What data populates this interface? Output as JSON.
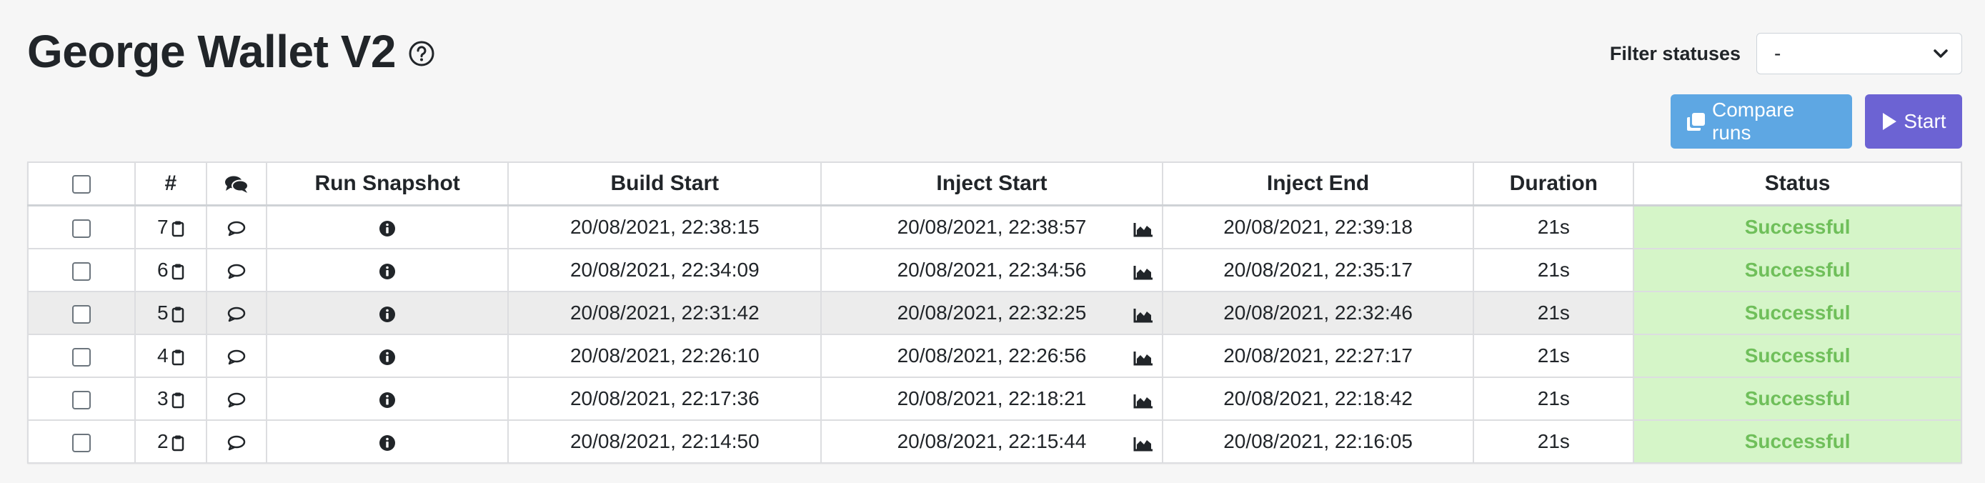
{
  "header": {
    "title": "George Wallet V2",
    "help_icon": "question-circle-icon"
  },
  "filter": {
    "label": "Filter statuses",
    "selected": "-"
  },
  "actions": {
    "compare_label": "Compare runs",
    "start_label": "Start"
  },
  "colors": {
    "compare_button": "#5ea7e3",
    "start_button": "#6c63d3",
    "status_success_bg": "#d5f5c8",
    "status_success_text": "#6fbf5a"
  },
  "table": {
    "columns": {
      "select": "",
      "number": "#",
      "comments": "",
      "snapshot": "Run Snapshot",
      "build_start": "Build Start",
      "inject_start": "Inject Start",
      "inject_end": "Inject End",
      "duration": "Duration",
      "status": "Status"
    },
    "rows": [
      {
        "id": "7",
        "build_start": "20/08/2021, 22:38:15",
        "inject_start": "20/08/2021, 22:38:57",
        "inject_end": "20/08/2021, 22:39:18",
        "duration": "21s",
        "status": "Successful"
      },
      {
        "id": "6",
        "build_start": "20/08/2021, 22:34:09",
        "inject_start": "20/08/2021, 22:34:56",
        "inject_end": "20/08/2021, 22:35:17",
        "duration": "21s",
        "status": "Successful"
      },
      {
        "id": "5",
        "build_start": "20/08/2021, 22:31:42",
        "inject_start": "20/08/2021, 22:32:25",
        "inject_end": "20/08/2021, 22:32:46",
        "duration": "21s",
        "status": "Successful"
      },
      {
        "id": "4",
        "build_start": "20/08/2021, 22:26:10",
        "inject_start": "20/08/2021, 22:26:56",
        "inject_end": "20/08/2021, 22:27:17",
        "duration": "21s",
        "status": "Successful"
      },
      {
        "id": "3",
        "build_start": "20/08/2021, 22:17:36",
        "inject_start": "20/08/2021, 22:18:21",
        "inject_end": "20/08/2021, 22:18:42",
        "duration": "21s",
        "status": "Successful"
      },
      {
        "id": "2",
        "build_start": "20/08/2021, 22:14:50",
        "inject_start": "20/08/2021, 22:15:44",
        "inject_end": "20/08/2021, 22:16:05",
        "duration": "21s",
        "status": "Successful"
      }
    ]
  }
}
